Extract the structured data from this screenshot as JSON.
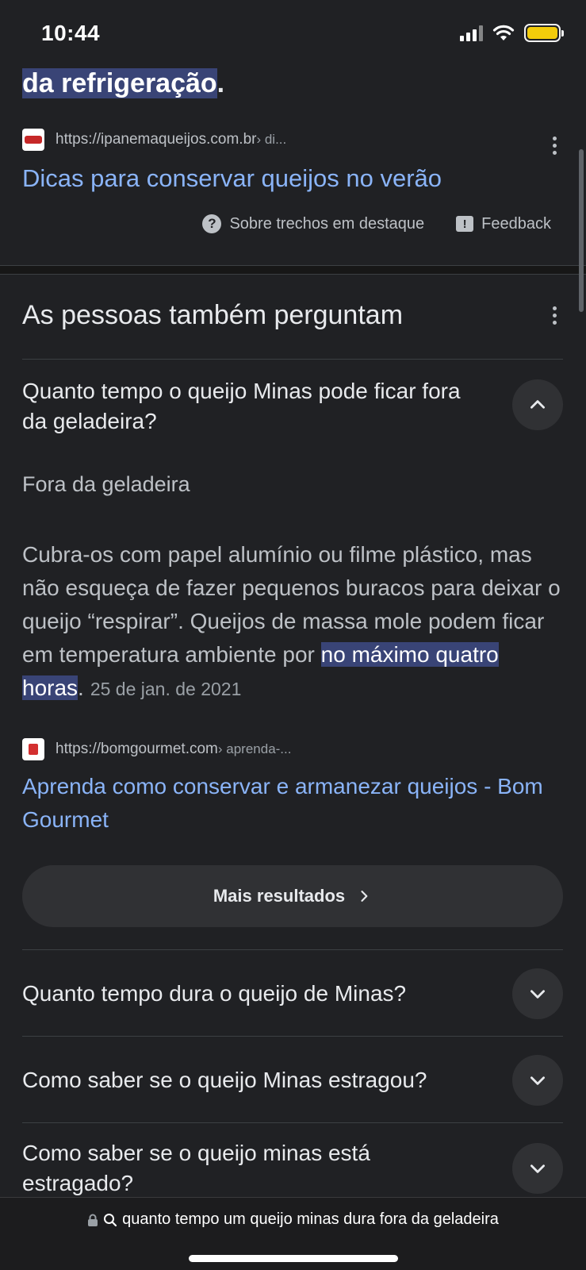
{
  "status_bar": {
    "time": "10:44",
    "battery_color": "#ffd60a"
  },
  "snippet": {
    "tail_highlight": "da refrigeração",
    "tail_end": ".",
    "source_url": "https://ipanemaqueijos.com.br",
    "source_path": " › di...",
    "link_title": "Dicas para conservar queijos no verão",
    "about_label": "Sobre trechos em destaque",
    "feedback_label": "Feedback"
  },
  "paa": {
    "title": "As pessoas também perguntam",
    "expanded": {
      "question": "Quanto tempo o queijo Minas pode ficar fora da geladeira?",
      "answer_title": "Fora da geladeira",
      "answer_text": "Cubra-os com papel alumínio ou filme plástico, mas não esqueça de fazer pequenos buracos para deixar o queijo “respirar”. Queijos de massa mole podem ficar em temperatura ambiente por ",
      "answer_highlight": "no máximo quatro horas",
      "answer_end": ".",
      "answer_date": "25 de jan. de 2021",
      "source_url": "https://bomgourmet.com",
      "source_path": " › aprenda-...",
      "link_title": "Aprenda como conservar e armanezar queijos - Bom Gourmet",
      "more_results": "Mais resultados"
    },
    "questions": [
      "Quanto tempo dura o queijo de Minas?",
      "Como saber se o queijo Minas estragou?",
      "Como saber se o queijo minas está estragado?"
    ]
  },
  "address_bar": {
    "query": "quanto tempo um queijo minas dura fora da geladeira"
  },
  "colors": {
    "background": "#202124",
    "link": "#8ab4f8",
    "highlight": "#394476"
  }
}
